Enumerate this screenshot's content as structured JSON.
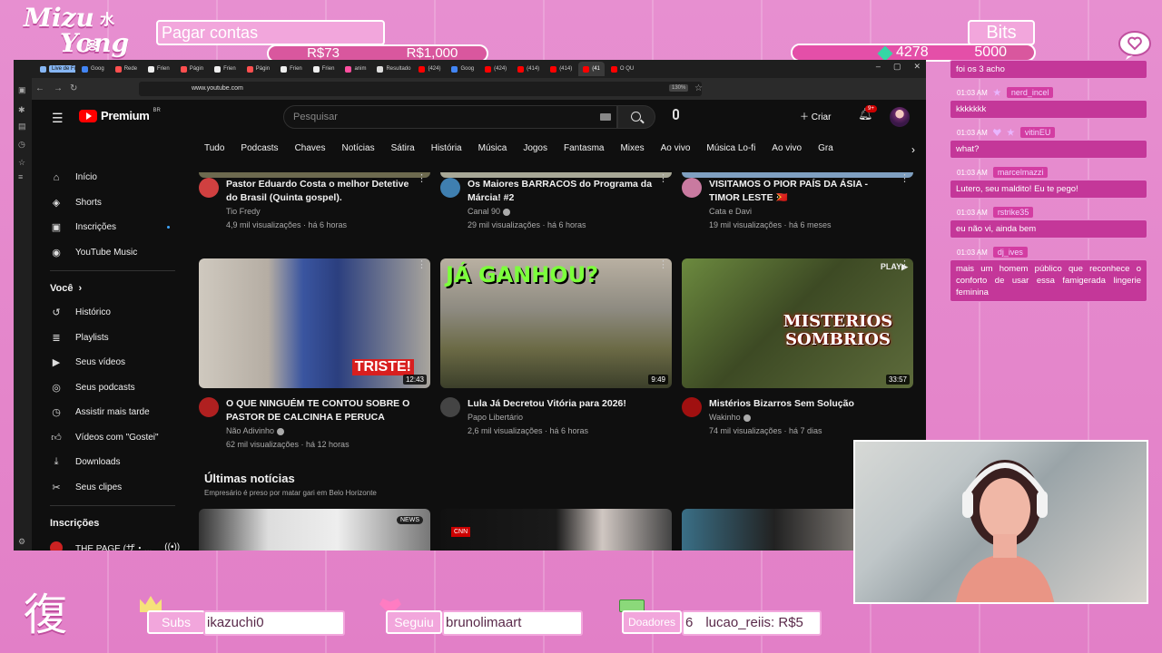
{
  "overlay": {
    "logo_line1": "Mizu",
    "logo_line2": "Yong",
    "logo_kanji": "水",
    "logo_hangul": "용",
    "task": "Pagar contas",
    "money_current": "R$73",
    "money_goal": "R$1,000",
    "bits_label": "Bits",
    "bits_current": "4278",
    "bits_goal": "5000",
    "bits_progress": 0.8556,
    "kanji_bottom": "復",
    "subs_label": "Subs",
    "subs_value": "ikazuchi0",
    "follow_label": "Seguiu",
    "follow_value": "brunolimaart",
    "donors_label": "Doadores",
    "donors_value": "6",
    "donor_top": "lucao_reiis: R$5"
  },
  "browser": {
    "tabs": [
      {
        "label": "Live de Filmes",
        "color": "#86b6f4",
        "badge": true
      },
      {
        "label": "Goog",
        "color": "#4285f4"
      },
      {
        "label": "Rede",
        "color": "#ff4f4f"
      },
      {
        "label": "Frien",
        "color": "#eeeeee"
      },
      {
        "label": "Págin",
        "color": "#ff4f4f"
      },
      {
        "label": "Frien",
        "color": "#eeeeee"
      },
      {
        "label": "Págin",
        "color": "#ff4f4f"
      },
      {
        "label": "Frien",
        "color": "#eeeeee"
      },
      {
        "label": "Frien",
        "color": "#eeeeee"
      },
      {
        "label": "anim",
        "color": "#ff4fa0"
      },
      {
        "label": "Resultado",
        "color": "#dddddd"
      },
      {
        "label": "(424)",
        "color": "#ff0000"
      },
      {
        "label": "Goog",
        "color": "#4285f4"
      },
      {
        "label": "(424)",
        "color": "#ff0000"
      },
      {
        "label": "(414)",
        "color": "#ff0000"
      },
      {
        "label": "(414)",
        "color": "#ff0000"
      },
      {
        "label": "(41",
        "color": "#ff0000",
        "active": true
      },
      {
        "label": "O QU",
        "color": "#ff0000"
      }
    ],
    "url": "www.youtube.com",
    "zoom": "130%"
  },
  "yt": {
    "brand": "Premium",
    "region": "BR",
    "search_placeholder": "Pesquisar",
    "create": "Criar",
    "notif_count": "9+",
    "chips": [
      "Tudo",
      "Podcasts",
      "Chaves",
      "Notícias",
      "Sátira",
      "História",
      "Música",
      "Jogos",
      "Fantasma",
      "Mixes",
      "Ao vivo",
      "Música Lo-fi",
      "Ao vivo",
      "Gra"
    ],
    "sidebar_main": [
      {
        "label": "Início",
        "icon": "home-icon"
      },
      {
        "label": "Shorts",
        "icon": "shorts-icon"
      },
      {
        "label": "Inscrições",
        "icon": "subscriptions-icon"
      },
      {
        "label": "YouTube Music",
        "icon": "music-icon"
      }
    ],
    "you_label": "Você",
    "sidebar_you": [
      {
        "label": "Histórico",
        "icon": "history-icon"
      },
      {
        "label": "Playlists",
        "icon": "playlist-icon"
      },
      {
        "label": "Seus vídeos",
        "icon": "video-icon"
      },
      {
        "label": "Seus podcasts",
        "icon": "podcast-icon"
      },
      {
        "label": "Assistir mais tarde",
        "icon": "clock-icon"
      },
      {
        "label": "Vídeos com \"Gostei\"",
        "icon": "thumbs-up-icon"
      },
      {
        "label": "Downloads",
        "icon": "download-icon"
      },
      {
        "label": "Seus clipes",
        "icon": "scissors-icon"
      }
    ],
    "subs_label": "Inscrições",
    "sub_channel": "THE PAGE (ザ・...",
    "row1": [
      {
        "title": "Pastor Eduardo Costa o melhor Detetive do Brasil (Quinta gospel).",
        "channel": "Tio Fredy",
        "stats": "4,9 mil visualizações · há 6 horas",
        "av": "#d04040",
        "verified": false
      },
      {
        "title": "Os Maiores BARRACOS do Programa da Márcia! #2",
        "channel": "Canal 90",
        "stats": "29 mil visualizações · há 6 horas",
        "av": "#3f7fb0",
        "verified": true
      },
      {
        "title": "VISITAMOS O PIOR PAÍS DA ÁSIA - TIMOR LESTE 🇹🇱",
        "channel": "Cata e Davi",
        "stats": "19 mil visualizações · há 6 meses",
        "av": "#c97aa0",
        "verified": false
      }
    ],
    "row2": [
      {
        "title": "O QUE NINGUÉM TE CONTOU SOBRE O PASTOR DE CALCINHA E PERUCA",
        "channel": "Não Adivinho",
        "stats": "62 mil visualizações · há 12 horas",
        "duration": "12:43",
        "overlay": "TRISTE!",
        "av": "#b02020",
        "verified": true
      },
      {
        "title": "Lula Já Decretou Vitória para 2026!",
        "channel": "Papo Libertário",
        "stats": "2,6 mil visualizações · há 6 horas",
        "duration": "9:49",
        "overlay": "JÁ GANHOU?",
        "av": "#444444",
        "verified": false
      },
      {
        "title": "Mistérios Bizarros Sem Solução",
        "channel": "Wakinho",
        "stats": "74 mil visualizações · há 7 dias",
        "duration": "33:57",
        "overlay": "MISTERIOS SOMBRIOS",
        "overlay_corner": "PLAY▶",
        "av": "#a01010",
        "verified": true
      }
    ],
    "news_title": "Últimas notícias",
    "news_sub": "Empresário é preso por matar gari em Belo Horizonte",
    "news_badges": [
      "NEWS",
      "CNN"
    ]
  },
  "chat": [
    {
      "time": "",
      "user": "",
      "badges": [],
      "text": "foi os 3 acho"
    },
    {
      "time": "01:03 AM",
      "user": "nerd_incel",
      "badges": [
        "star"
      ],
      "text": "kkkkkkk"
    },
    {
      "time": "01:03 AM",
      "user": "vitinEU",
      "badges": [
        "heart",
        "star"
      ],
      "text": "what?"
    },
    {
      "time": "01:03 AM",
      "user": "marcelmazzi",
      "badges": [],
      "text": "Lutero, seu maldito! Eu te pego!"
    },
    {
      "time": "01:03 AM",
      "user": "rstrike35",
      "badges": [],
      "text": "eu não vi, ainda bem"
    },
    {
      "time": "01:03 AM",
      "user": "dj_ives",
      "badges": [],
      "text": "mais um homem público que reconhece o conforto de usar essa famigerada lingerie feminina"
    }
  ]
}
